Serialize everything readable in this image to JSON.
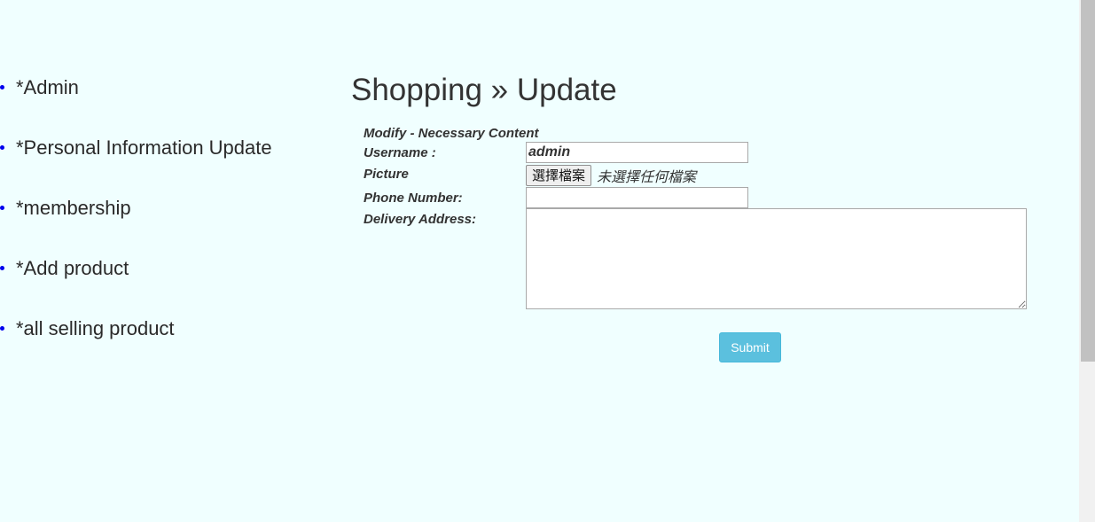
{
  "sidebar": {
    "items": [
      {
        "label": "*Admin"
      },
      {
        "label": "*Personal Information Update"
      },
      {
        "label": "*membership"
      },
      {
        "label": "*Add product"
      },
      {
        "label": "*all selling product"
      }
    ]
  },
  "main": {
    "title": "Shopping » Update",
    "form": {
      "caption": "Modify - Necessary Content",
      "username_label": "Username :",
      "username_value": "admin",
      "picture_label": "Picture",
      "file_button_label": "選擇檔案",
      "file_status": "未選擇任何檔案",
      "phone_label": "Phone Number:",
      "phone_value": "",
      "address_label": "Delivery Address:",
      "address_value": "",
      "submit_label": "Submit"
    }
  },
  "colors": {
    "background": "#f0ffff",
    "bullet": "#0000ee",
    "submit": "#5bc0de"
  }
}
